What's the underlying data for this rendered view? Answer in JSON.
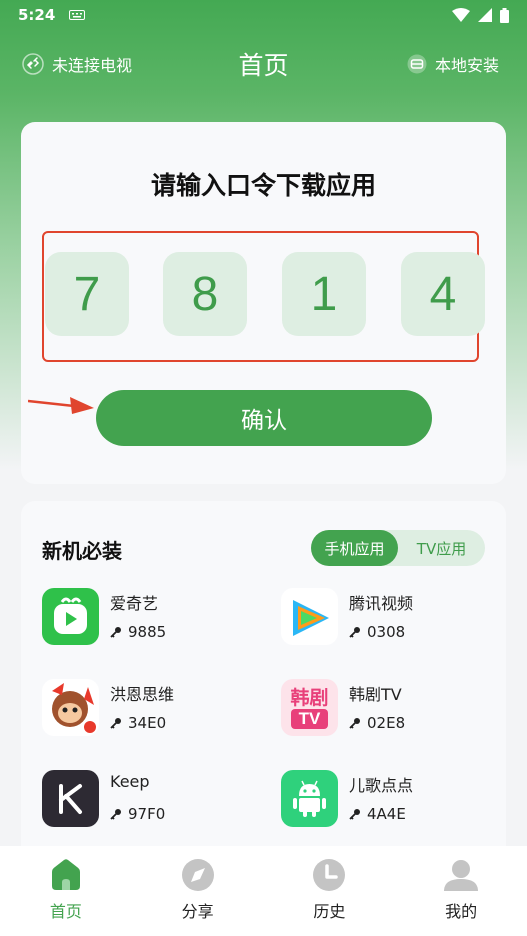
{
  "status_bar": {
    "time": "5:24"
  },
  "header": {
    "left_label": "未连接电视",
    "title": "首页",
    "right_label": "本地安装"
  },
  "code_card": {
    "prompt": "请输入口令下载应用",
    "digits": [
      "7",
      "8",
      "1",
      "4"
    ],
    "confirm_label": "确认"
  },
  "apps_section": {
    "title": "新机必装",
    "tabs": [
      {
        "label": "手机应用",
        "active": true
      },
      {
        "label": "TV应用",
        "active": false
      }
    ],
    "apps": [
      {
        "name": "爱奇艺",
        "code": "9885"
      },
      {
        "name": "腾讯视频",
        "code": "0308"
      },
      {
        "name": "洪恩思维",
        "code": "34E0"
      },
      {
        "name": "韩剧TV",
        "code": "02E8"
      },
      {
        "name": "Keep",
        "code": "97F0"
      },
      {
        "name": "儿歌点点",
        "code": "4A4E"
      }
    ],
    "hanju_icon_text_top": "韩剧",
    "hanju_icon_text_bottom": "TV"
  },
  "bottom_nav": [
    {
      "label": "首页",
      "icon": "home-icon",
      "active": true
    },
    {
      "label": "分享",
      "icon": "compass-icon",
      "active": false
    },
    {
      "label": "历史",
      "icon": "clock-icon",
      "active": false
    },
    {
      "label": "我的",
      "icon": "user-icon",
      "active": false
    }
  ],
  "colors": {
    "primary": "#43a34f",
    "digit_bg": "#deeee2",
    "highlight_border": "#e0452e"
  }
}
